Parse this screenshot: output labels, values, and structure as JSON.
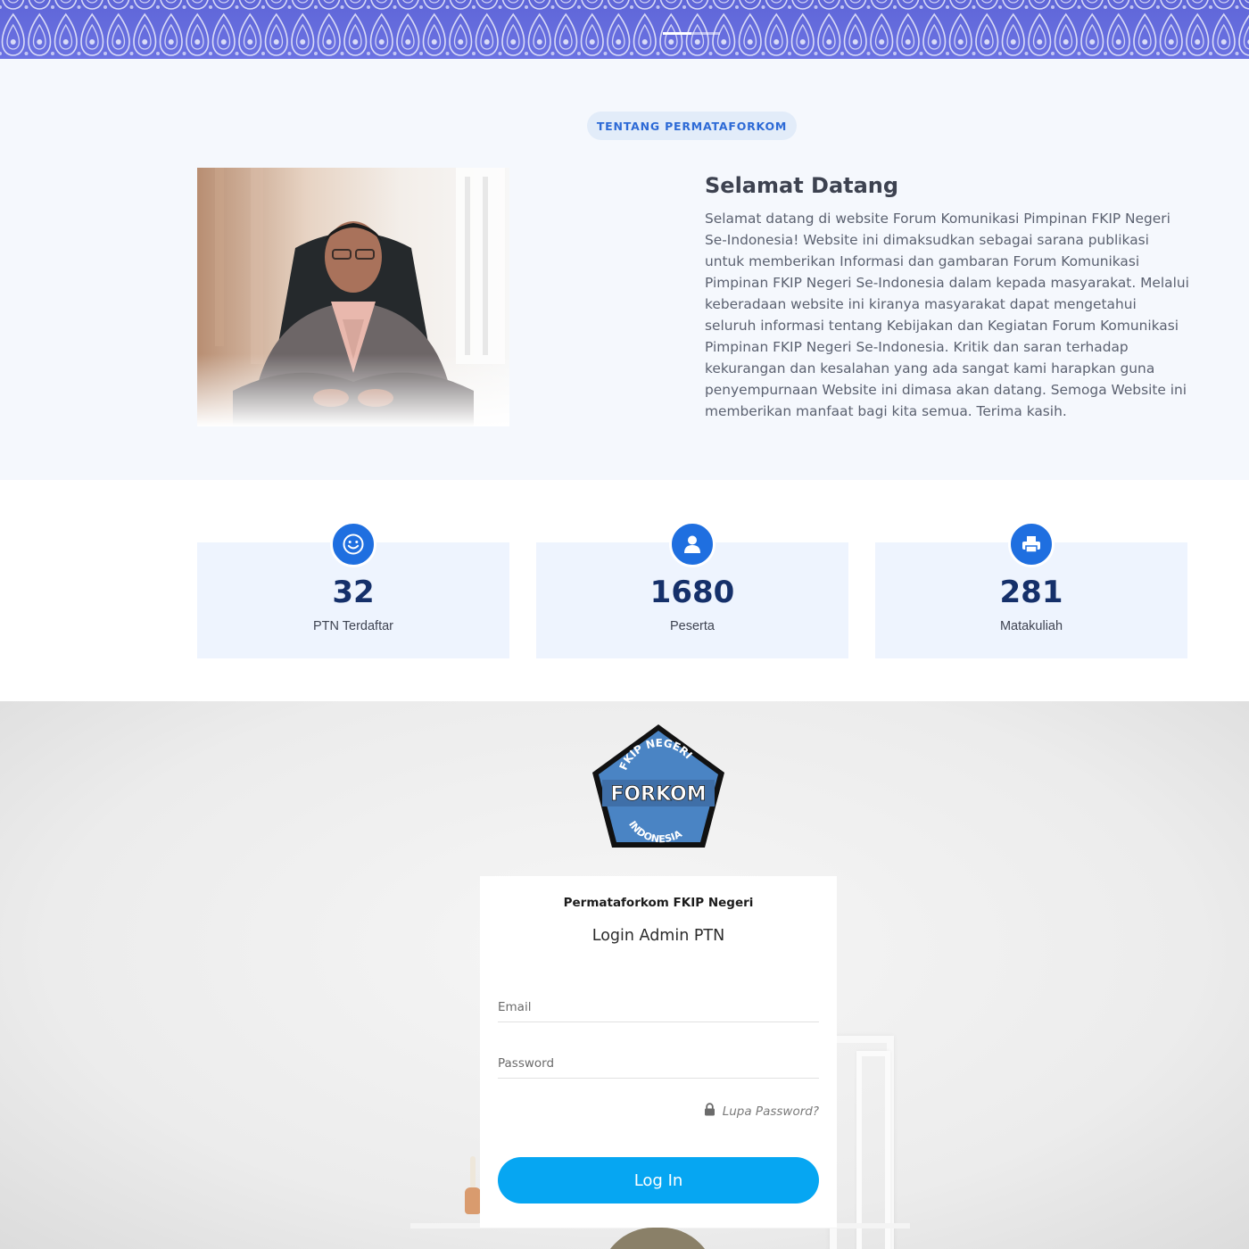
{
  "hero": {
    "slides": [
      {
        "active": true
      },
      {
        "active": false
      }
    ],
    "colors": {
      "background": "#6a70e0",
      "pattern": "#ffffff"
    }
  },
  "about": {
    "section_label": "TENTANG PERMATAFORKOM",
    "title": "Selamat Datang",
    "body": "Selamat datang di website Forum Komunikasi Pimpinan FKIP Negeri Se-Indonesia! Website ini dimaksudkan sebagai sarana publikasi untuk memberikan Informasi dan gambaran Forum Komunikasi Pimpinan FKIP Negeri Se-Indonesia dalam kepada masyarakat. Melalui keberadaan website ini kiranya masyarakat dapat mengetahui seluruh informasi tentang Kebijakan dan Kegiatan Forum Komunikasi Pimpinan FKIP Negeri Se-Indonesia. Kritik dan saran terhadap kekurangan dan kesalahan yang ada sangat kami harapkan guna penyempurnaan Website ini dimasa akan datang. Semoga Website ini memberikan manfaat bagi kita semua. Terima kasih."
  },
  "stats": [
    {
      "icon": "smiley-icon",
      "value": "32",
      "label": "PTN Terdaftar"
    },
    {
      "icon": "user-icon",
      "value": "1680",
      "label": "Peserta"
    },
    {
      "icon": "printer-icon",
      "value": "281",
      "label": "Matakuliah"
    }
  ],
  "logo": {
    "top_text": "FKIP NEGERI",
    "center_text": "FORKOM",
    "bottom_text": "INDONESIA"
  },
  "login": {
    "org_name": "Permataforkom FKIP Negeri",
    "title": "Login Admin PTN",
    "email_placeholder": "Email",
    "password_placeholder": "Password",
    "forgot_label": "Lupa Password?",
    "submit_label": "Log In"
  },
  "colors": {
    "accent": "#1f6fe0",
    "button": "#06a6f2",
    "stat_number": "#15306a",
    "pill_text": "#2d6ad6"
  }
}
